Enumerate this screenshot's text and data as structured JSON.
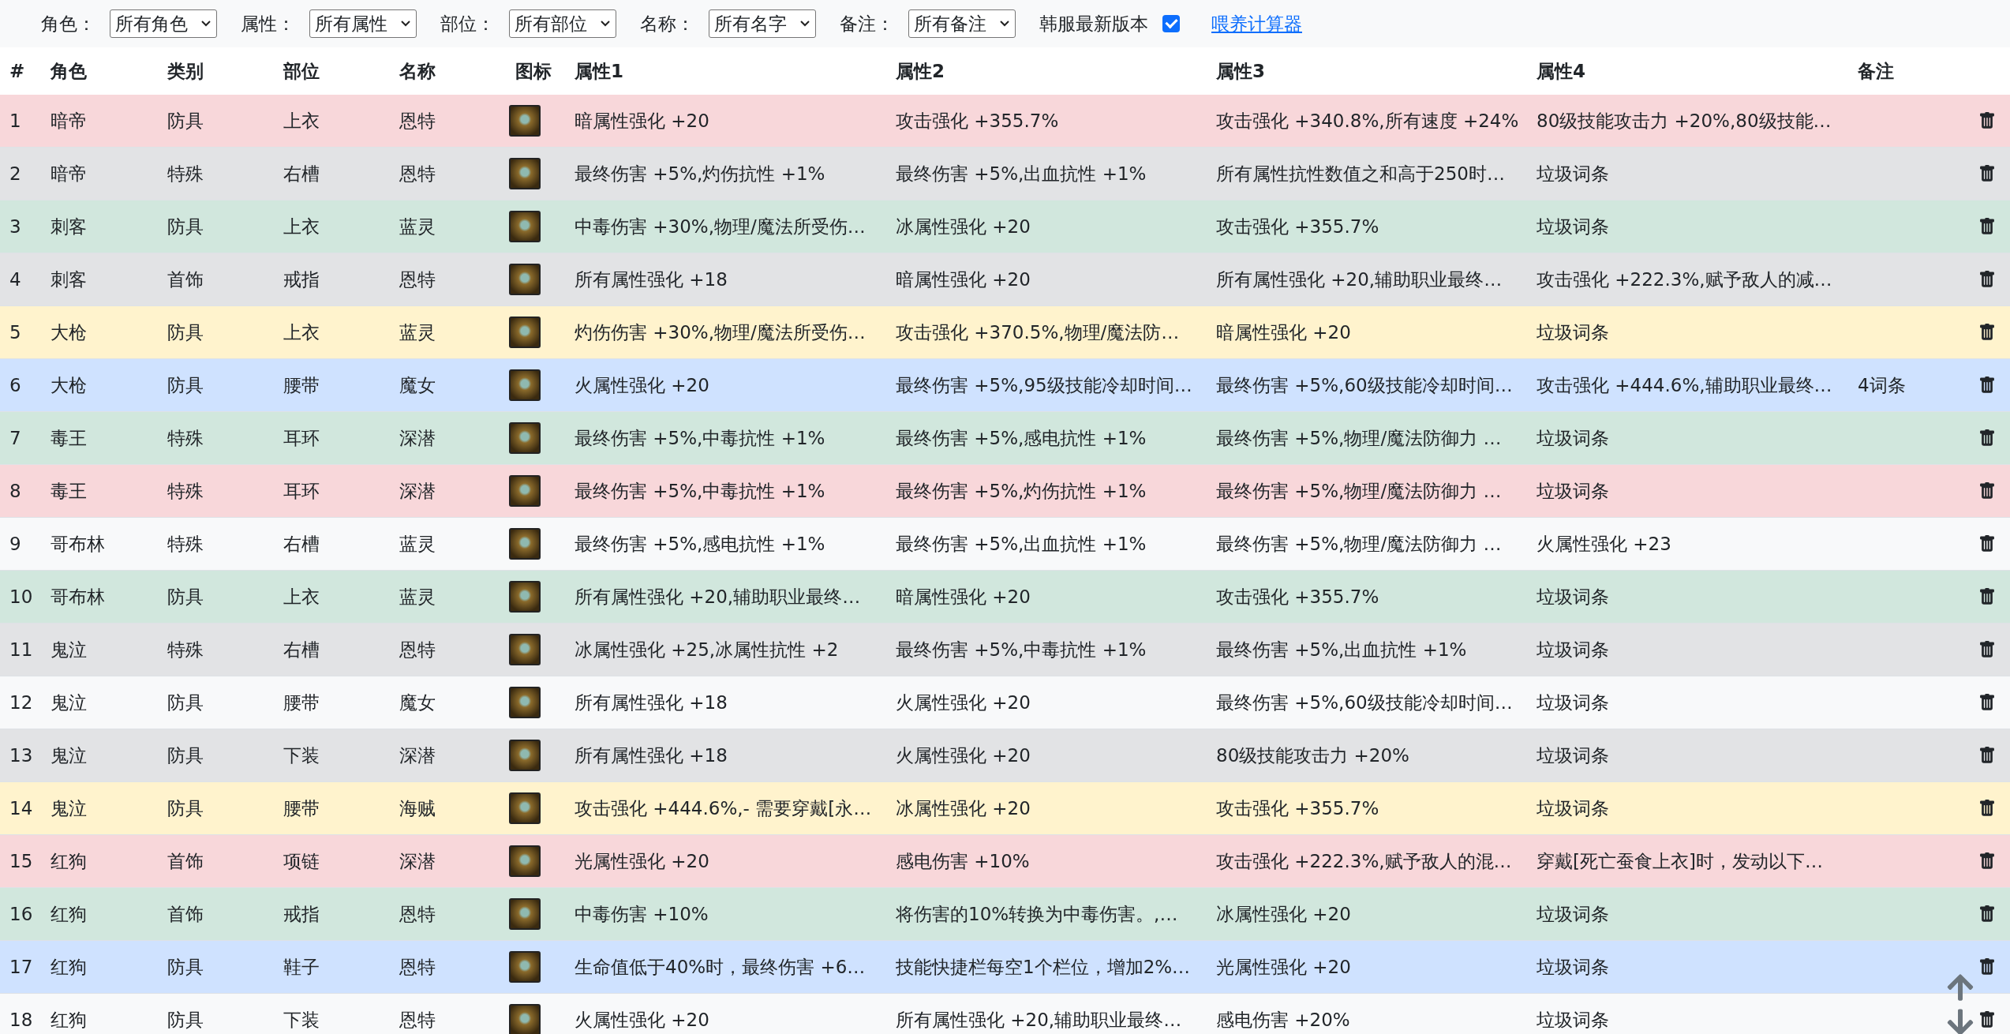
{
  "filters": [
    {
      "label": "角色：",
      "value": "所有角色"
    },
    {
      "label": "属性：",
      "value": "所有属性"
    },
    {
      "label": "部位：",
      "value": "所有部位"
    },
    {
      "label": "名称：",
      "value": "所有名字"
    },
    {
      "label": "备注：",
      "value": "所有备注"
    }
  ],
  "kr_version": {
    "label": "韩服最新版本",
    "checked": true
  },
  "link": "喂养计算器",
  "table": {
    "columns": [
      "#",
      "角色",
      "类别",
      "部位",
      "名称",
      "图标",
      "属性1",
      "属性2",
      "属性3",
      "属性4",
      "备注"
    ],
    "rows": [
      {
        "index": "1",
        "role": "暗帝",
        "category": "防具",
        "slot": "上衣",
        "name": "恩特",
        "attr1": "暗属性强化 +20",
        "attr2": "攻击强化 +355.7%",
        "attr3": "攻击强化 +340.8%,所有速度 +24%",
        "attr4": "80级技能攻击力 +20%,80级技能…",
        "color": "#f8d7da"
      },
      {
        "index": "2",
        "role": "暗帝",
        "category": "特殊",
        "slot": "右槽",
        "name": "恩特",
        "attr1": "最终伤害 +5%,灼伤抗性 +1%",
        "attr2": "最终伤害 +5%,出血抗性 +1%",
        "attr3": "所有属性抗性数值之和高于250时…",
        "attr4": "垃圾词条",
        "color": "#e2e3e5"
      },
      {
        "index": "3",
        "role": "刺客",
        "category": "防具",
        "slot": "上衣",
        "name": "蓝灵",
        "attr1": "中毒伤害 +30%,物理/魔法所受伤…",
        "attr2": "冰属性强化 +20",
        "attr3": "攻击强化 +355.7%",
        "attr4": "垃圾词条",
        "color": "#d1e7dd"
      },
      {
        "index": "4",
        "role": "刺客",
        "category": "首饰",
        "slot": "戒指",
        "name": "恩特",
        "attr1": "所有属性强化 +18",
        "attr2": "暗属性强化 +20",
        "attr3": "所有属性强化 +20,辅助职业最终…",
        "attr4": "攻击强化 +222.3%,赋予敌人的减…",
        "color": "#e2e3e5"
      },
      {
        "index": "5",
        "role": "大枪",
        "category": "防具",
        "slot": "上衣",
        "name": "蓝灵",
        "attr1": "灼伤伤害 +30%,物理/魔法所受伤…",
        "attr2": "攻击强化 +370.5%,物理/魔法防…",
        "attr3": "暗属性强化 +20",
        "attr4": "垃圾词条",
        "color": "#fff3cd"
      },
      {
        "index": "6",
        "role": "大枪",
        "category": "防具",
        "slot": "腰带",
        "name": "魔女",
        "attr1": "火属性强化 +20",
        "attr2": "最终伤害 +5%,95级技能冷却时间…",
        "attr3": "最终伤害 +5%,60级技能冷却时间…",
        "attr4": "攻击强化 +444.6%,辅助职业最终…",
        "note": "4词条",
        "color": "#cfe2ff"
      },
      {
        "index": "7",
        "role": "毒王",
        "category": "特殊",
        "slot": "耳环",
        "name": "深潜",
        "attr1": "最终伤害 +5%,中毒抗性 +1%",
        "attr2": "最终伤害 +5%,感电抗性 +1%",
        "attr3": "最终伤害 +5%,物理/魔法防御力 …",
        "attr4": "垃圾词条",
        "color": "#d1e7dd"
      },
      {
        "index": "8",
        "role": "毒王",
        "category": "特殊",
        "slot": "耳环",
        "name": "深潜",
        "attr1": "最终伤害 +5%,中毒抗性 +1%",
        "attr2": "最终伤害 +5%,灼伤抗性 +1%",
        "attr3": "最终伤害 +5%,物理/魔法防御力 …",
        "attr4": "垃圾词条",
        "color": "#f8d7da"
      },
      {
        "index": "9",
        "role": "哥布林",
        "category": "特殊",
        "slot": "右槽",
        "name": "蓝灵",
        "attr1": "最终伤害 +5%,感电抗性 +1%",
        "attr2": "最终伤害 +5%,出血抗性 +1%",
        "attr3": "最终伤害 +5%,物理/魔法防御力 …",
        "attr4": "火属性强化 +23",
        "color": "#f8f9fa"
      },
      {
        "index": "10",
        "role": "哥布林",
        "category": "防具",
        "slot": "上衣",
        "name": "蓝灵",
        "attr1": "所有属性强化 +20,辅助职业最终…",
        "attr2": "暗属性强化 +20",
        "attr3": "攻击强化 +355.7%",
        "attr4": "垃圾词条",
        "color": "#d1e7dd"
      },
      {
        "index": "11",
        "role": "鬼泣",
        "category": "特殊",
        "slot": "右槽",
        "name": "恩特",
        "attr1": "冰属性强化 +25,冰属性抗性 +2",
        "attr2": "最终伤害 +5%,中毒抗性 +1%",
        "attr3": "最终伤害 +5%,出血抗性 +1%",
        "attr4": "垃圾词条",
        "color": "#e2e3e5"
      },
      {
        "index": "12",
        "role": "鬼泣",
        "category": "防具",
        "slot": "腰带",
        "name": "魔女",
        "attr1": "所有属性强化 +18",
        "attr2": "火属性强化 +20",
        "attr3": "最终伤害 +5%,60级技能冷却时间…",
        "attr4": "垃圾词条",
        "color": "#f8f9fa"
      },
      {
        "index": "13",
        "role": "鬼泣",
        "category": "防具",
        "slot": "下装",
        "name": "深潜",
        "attr1": "所有属性强化 +18",
        "attr2": "火属性强化 +20",
        "attr3": "80级技能攻击力 +20%",
        "attr4": "垃圾词条",
        "color": "#e2e3e5"
      },
      {
        "index": "14",
        "role": "鬼泣",
        "category": "防具",
        "slot": "腰带",
        "name": "海贼",
        "attr1": "攻击强化 +444.6%,- 需要穿戴[永…",
        "attr2": "冰属性强化 +20",
        "attr3": "攻击强化 +355.7%",
        "attr4": "垃圾词条",
        "color": "#fff3cd"
      },
      {
        "index": "15",
        "role": "红狗",
        "category": "首饰",
        "slot": "项链",
        "name": "深潜",
        "attr1": "光属性强化 +20",
        "attr2": "感电伤害 +10%",
        "attr3": "攻击强化 +222.3%,赋予敌人的混…",
        "attr4": "穿戴[死亡蚕食上衣]时，发动以下…",
        "color": "#f8d7da"
      },
      {
        "index": "16",
        "role": "红狗",
        "category": "首饰",
        "slot": "戒指",
        "name": "恩特",
        "attr1": "中毒伤害 +10%",
        "attr2": "将伤害的10%转换为中毒伤害。,…",
        "attr3": "冰属性强化 +20",
        "attr4": "垃圾词条",
        "color": "#d1e7dd"
      },
      {
        "index": "17",
        "role": "红狗",
        "category": "防具",
        "slot": "鞋子",
        "name": "恩特",
        "attr1": "生命值低于40%时，最终伤害 +6…",
        "attr2": "技能快捷栏每空1个栏位，增加2%…",
        "attr3": "光属性强化 +20",
        "attr4": "垃圾词条",
        "color": "#cfe2ff"
      },
      {
        "index": "18",
        "role": "红狗",
        "category": "防具",
        "slot": "下装",
        "name": "恩特",
        "attr1": "火属性强化 +20",
        "attr2": "所有属性强化 +20,辅助职业最终…",
        "attr3": "感电伤害 +20%",
        "attr4": "垃圾词条",
        "color": "#f8f9fa"
      }
    ]
  }
}
